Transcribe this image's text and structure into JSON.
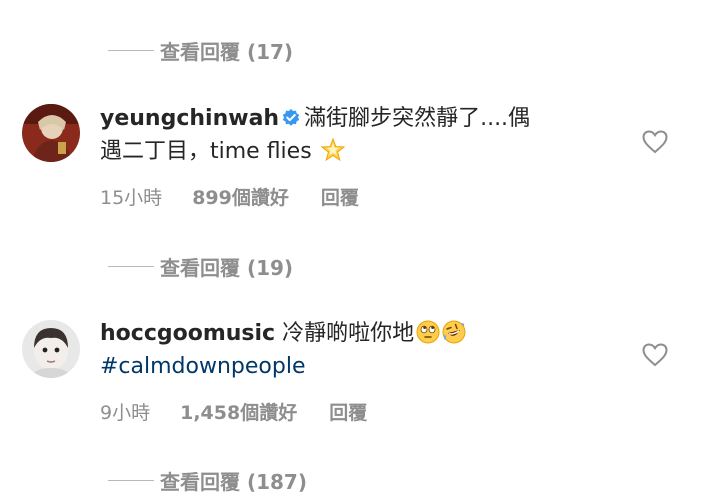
{
  "view_replies_1": {
    "label": "查看回覆 (17)"
  },
  "comments": [
    {
      "username": "yeungchinwah",
      "text_line1": "滿街腳步突然靜了....偶",
      "text_line2": "遇二丁目，time flies",
      "time": "15小時",
      "likes": "899個讚好",
      "reply": "回覆",
      "verified": true,
      "emoji": "glowing-star"
    },
    {
      "username": "hoccgoomusic",
      "text_line1": "冷靜啲啦你地",
      "hashtag": "#calmdownpeople",
      "time": "9小時",
      "likes": "1,458個讚好",
      "reply": "回覆",
      "verified": false,
      "emojis": [
        "face-with-rolling-eyes",
        "rolling-on-the-floor-laughing"
      ]
    }
  ],
  "view_replies_2": {
    "label": "查看回覆 (19)"
  },
  "view_replies_3": {
    "label": "查看回覆 (187)"
  },
  "colors": {
    "text": "#262626",
    "secondary": "#8e8e8e",
    "hashtag": "#00376b",
    "verified": "#3897f0"
  }
}
